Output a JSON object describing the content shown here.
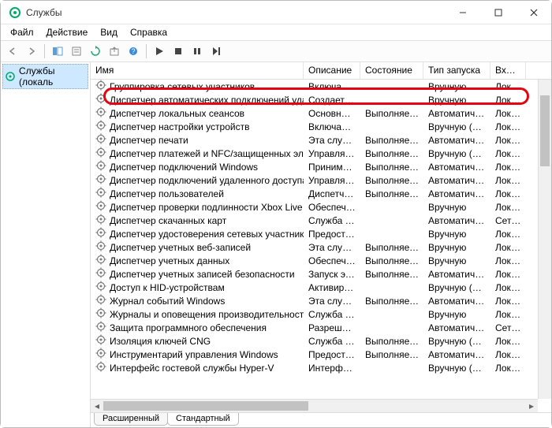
{
  "window": {
    "title": "Службы"
  },
  "menu": {
    "file": "Файл",
    "action": "Действие",
    "view": "Вид",
    "help": "Справка"
  },
  "tree": {
    "root": "Службы (локаль"
  },
  "columns": {
    "name": "Имя",
    "description": "Описание",
    "state": "Состояние",
    "startup": "Тип запуска",
    "logon": "Вход с"
  },
  "services": [
    {
      "name": "Группировка сетевых участников",
      "desc": "Включает …",
      "state": "",
      "start": "Вручную",
      "logon": "Локал"
    },
    {
      "name": "Диспетчер автоматических подключений удаленного…",
      "desc": "Создает п…",
      "state": "",
      "start": "Вручную",
      "logon": "Локал"
    },
    {
      "name": "Диспетчер локальных сеансов",
      "desc": "Основная …",
      "state": "Выполняется",
      "start": "Автоматиче…",
      "logon": "Локал"
    },
    {
      "name": "Диспетчер настройки устройств",
      "desc": "Включает …",
      "state": "",
      "start": "Вручную (ак…",
      "logon": "Локал"
    },
    {
      "name": "Диспетчер печати",
      "desc": "Эта служб…",
      "state": "Выполняется",
      "start": "Автоматиче…",
      "logon": "Локал"
    },
    {
      "name": "Диспетчер платежей и NFC/защищенных элементов",
      "desc": "Управляет…",
      "state": "Выполняется",
      "start": "Вручную (ак…",
      "logon": "Локал"
    },
    {
      "name": "Диспетчер подключений Windows",
      "desc": "Принимае…",
      "state": "Выполняется",
      "start": "Автоматиче…",
      "logon": "Локал"
    },
    {
      "name": "Диспетчер подключений удаленного доступа",
      "desc": "Управляет…",
      "state": "Выполняется",
      "start": "Автоматиче…",
      "logon": "Локал"
    },
    {
      "name": "Диспетчер пользователей",
      "desc": "Диспетчер…",
      "state": "Выполняется",
      "start": "Автоматиче…",
      "logon": "Локал"
    },
    {
      "name": "Диспетчер проверки подлинности Xbox Live",
      "desc": "Обеспечи…",
      "state": "",
      "start": "Вручную",
      "logon": "Локал"
    },
    {
      "name": "Диспетчер скачанных карт",
      "desc": "Служба W…",
      "state": "",
      "start": "Автоматиче…",
      "logon": "Сетев"
    },
    {
      "name": "Диспетчер удостоверения сетевых участников",
      "desc": "Предостав…",
      "state": "",
      "start": "Вручную",
      "logon": "Локал"
    },
    {
      "name": "Диспетчер учетных веб-записей",
      "desc": "Эта служб…",
      "state": "Выполняется",
      "start": "Вручную",
      "logon": "Локал"
    },
    {
      "name": "Диспетчер учетных данных",
      "desc": "Обеспечи…",
      "state": "Выполняется",
      "start": "Вручную",
      "logon": "Локал"
    },
    {
      "name": "Диспетчер учетных записей безопасности",
      "desc": "Запуск это…",
      "state": "Выполняется",
      "start": "Автоматиче…",
      "logon": "Локал"
    },
    {
      "name": "Доступ к HID-устройствам",
      "desc": "Активируе…",
      "state": "",
      "start": "Вручную (ак…",
      "logon": "Локал"
    },
    {
      "name": "Журнал событий Windows",
      "desc": "Эта служб…",
      "state": "Выполняется",
      "start": "Автоматиче…",
      "logon": "Локал"
    },
    {
      "name": "Журналы и оповещения производительности",
      "desc": "Служба ж…",
      "state": "",
      "start": "Вручную",
      "logon": "Локал"
    },
    {
      "name": "Защита программного обеспечения",
      "desc": "Разрешает…",
      "state": "",
      "start": "Автоматиче…",
      "logon": "Сетев"
    },
    {
      "name": "Изоляция ключей CNG",
      "desc": "Служба из…",
      "state": "Выполняется",
      "start": "Вручную (ак…",
      "logon": "Локал"
    },
    {
      "name": "Инструментарий управления Windows",
      "desc": "Предостав…",
      "state": "Выполняется",
      "start": "Автоматиче…",
      "logon": "Локал"
    },
    {
      "name": "Интерфейс гостевой службы Hyper-V",
      "desc": "Интерфей…",
      "state": "",
      "start": "Вручную (ак…",
      "logon": "Локал"
    }
  ],
  "tabs": {
    "extended": "Расширенный",
    "standard": "Стандартный"
  }
}
